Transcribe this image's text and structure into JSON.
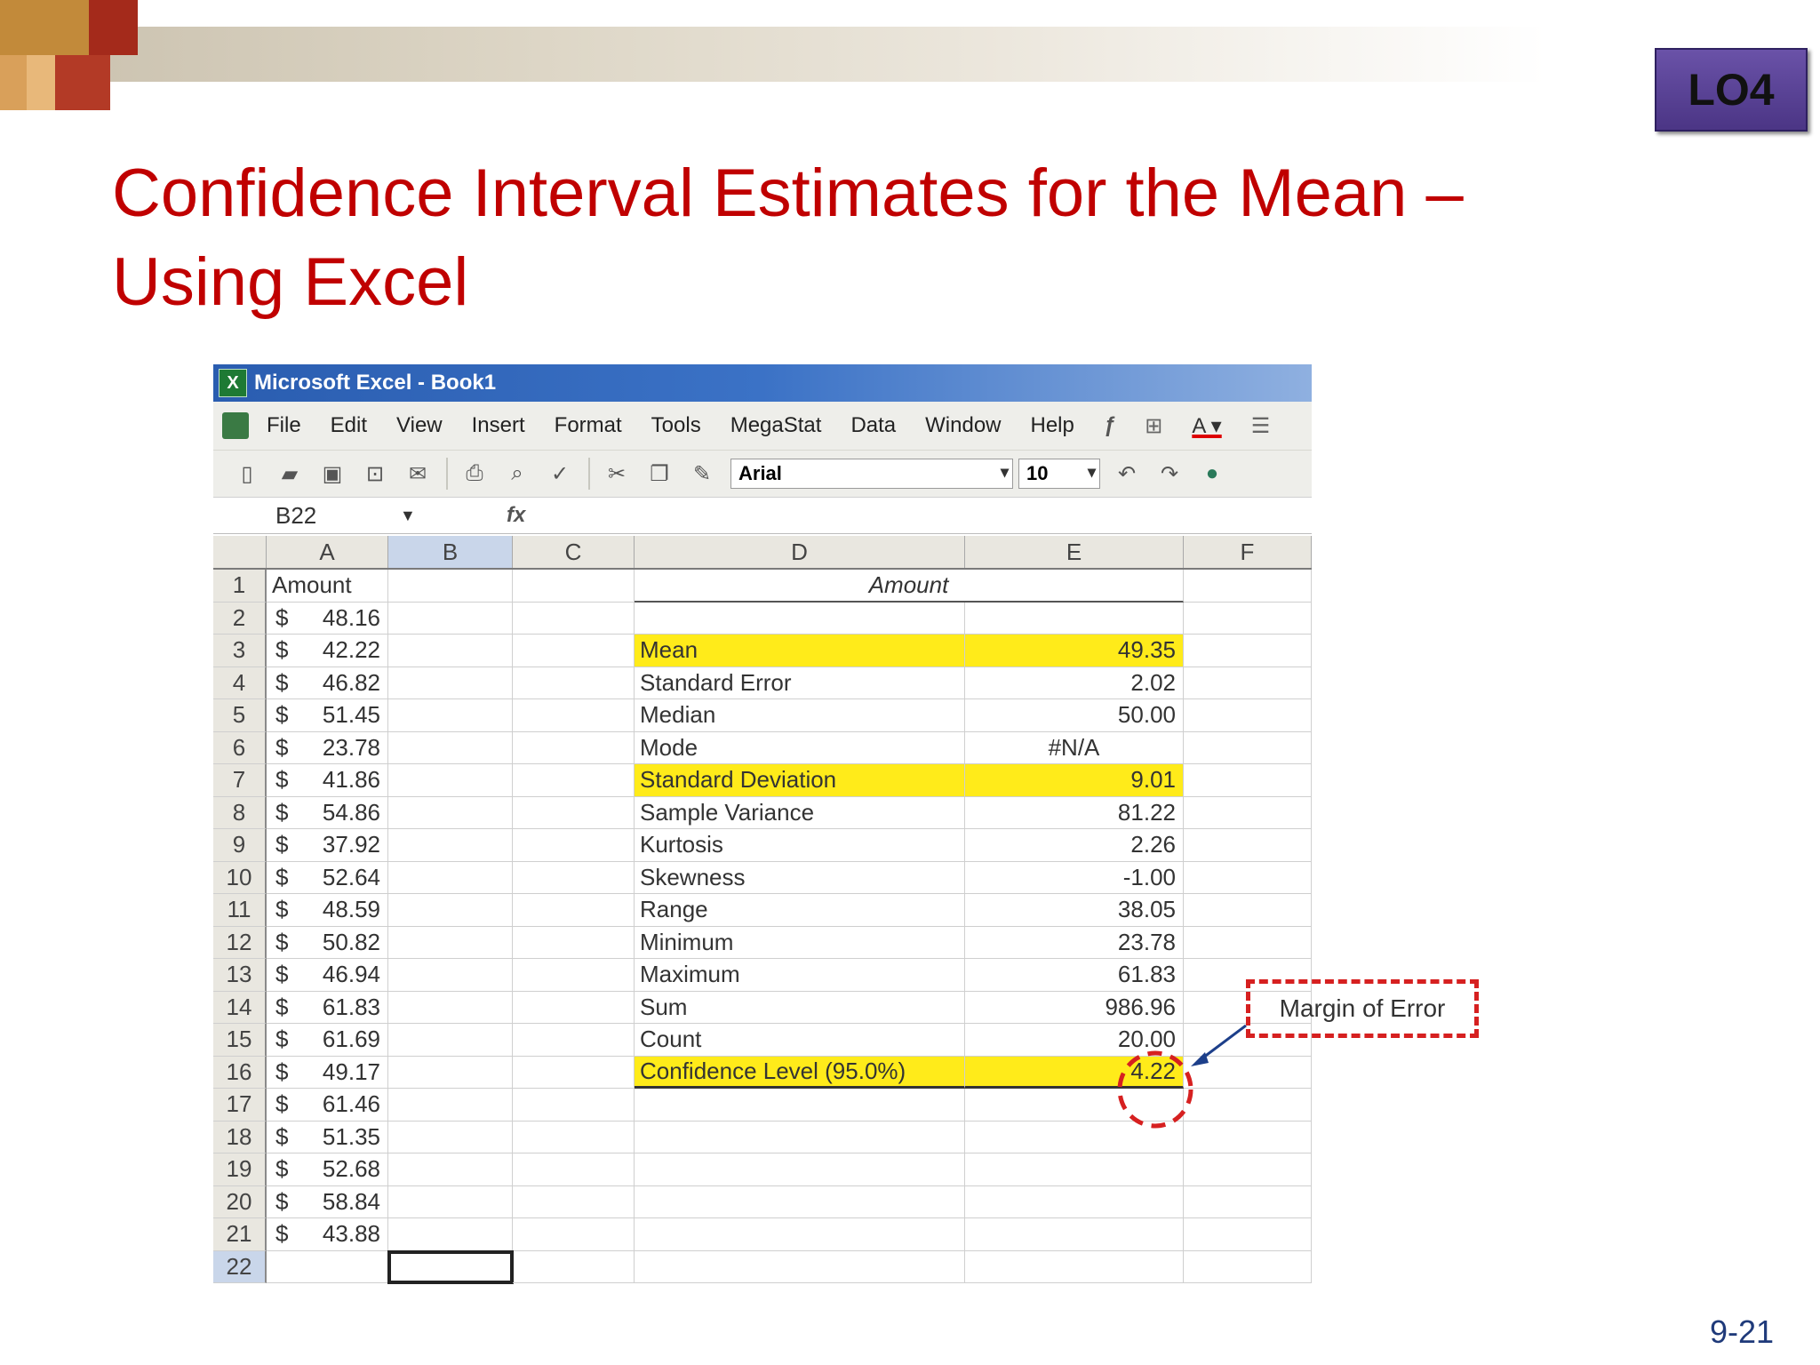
{
  "slide": {
    "badge": "LO4",
    "title_line1": "Confidence Interval Estimates for the Mean –",
    "title_line2": "Using Excel",
    "page_number": "9-21"
  },
  "excel": {
    "window_title": "Microsoft Excel - Book1",
    "menu": [
      "File",
      "Edit",
      "View",
      "Insert",
      "Format",
      "Tools",
      "MegaStat",
      "Data",
      "Window",
      "Help"
    ],
    "font_name": "Arial",
    "font_size": "10",
    "name_box": "B22",
    "fx": "fx",
    "columns": [
      "A",
      "B",
      "C",
      "D",
      "E",
      "F"
    ],
    "rows": [
      {
        "n": "1",
        "a_text": "Amount",
        "d": "",
        "e": ""
      },
      {
        "n": "2",
        "a_cur": "$",
        "a_val": "48.16",
        "d": "",
        "e": ""
      },
      {
        "n": "3",
        "a_cur": "$",
        "a_val": "42.22",
        "d": "Mean",
        "e": "49.35"
      },
      {
        "n": "4",
        "a_cur": "$",
        "a_val": "46.82",
        "d": "Standard Error",
        "e": "2.02"
      },
      {
        "n": "5",
        "a_cur": "$",
        "a_val": "51.45",
        "d": "Median",
        "e": "50.00"
      },
      {
        "n": "6",
        "a_cur": "$",
        "a_val": "23.78",
        "d": "Mode",
        "e": "#N/A"
      },
      {
        "n": "7",
        "a_cur": "$",
        "a_val": "41.86",
        "d": "Standard Deviation",
        "e": "9.01"
      },
      {
        "n": "8",
        "a_cur": "$",
        "a_val": "54.86",
        "d": "Sample Variance",
        "e": "81.22"
      },
      {
        "n": "9",
        "a_cur": "$",
        "a_val": "37.92",
        "d": "Kurtosis",
        "e": "2.26"
      },
      {
        "n": "10",
        "a_cur": "$",
        "a_val": "52.64",
        "d": "Skewness",
        "e": "-1.00"
      },
      {
        "n": "11",
        "a_cur": "$",
        "a_val": "48.59",
        "d": "Range",
        "e": "38.05"
      },
      {
        "n": "12",
        "a_cur": "$",
        "a_val": "50.82",
        "d": "Minimum",
        "e": "23.78"
      },
      {
        "n": "13",
        "a_cur": "$",
        "a_val": "46.94",
        "d": "Maximum",
        "e": "61.83"
      },
      {
        "n": "14",
        "a_cur": "$",
        "a_val": "61.83",
        "d": "Sum",
        "e": "986.96"
      },
      {
        "n": "15",
        "a_cur": "$",
        "a_val": "61.69",
        "d": "Count",
        "e": "20.00"
      },
      {
        "n": "16",
        "a_cur": "$",
        "a_val": "49.17",
        "d": "Confidence Level  (95.0%)",
        "e": "4.22"
      },
      {
        "n": "17",
        "a_cur": "$",
        "a_val": "61.46",
        "d": "",
        "e": ""
      },
      {
        "n": "18",
        "a_cur": "$",
        "a_val": "51.35",
        "d": "",
        "e": ""
      },
      {
        "n": "19",
        "a_cur": "$",
        "a_val": "52.68",
        "d": "",
        "e": ""
      },
      {
        "n": "20",
        "a_cur": "$",
        "a_val": "58.84",
        "d": "",
        "e": ""
      },
      {
        "n": "21",
        "a_cur": "$",
        "a_val": "43.88",
        "d": "",
        "e": ""
      },
      {
        "n": "22",
        "a_cur": "",
        "a_val": "",
        "d": "",
        "e": ""
      }
    ],
    "d_header": "Amount",
    "annotation": "Margin of Error",
    "highlight_color": "#ffeb1a",
    "annotation_color": "#d62020"
  }
}
